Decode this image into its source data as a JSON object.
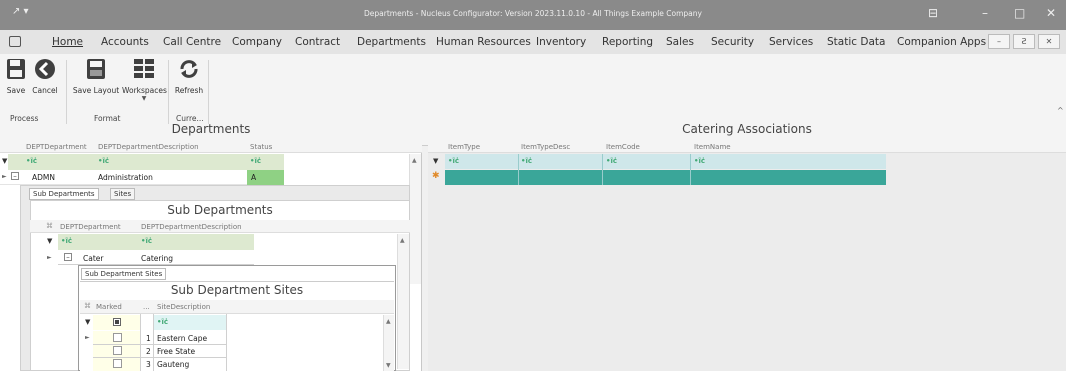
{
  "window": {
    "title": "Departments - Nucleus Configurator: Version 2023.11.0.10 - All Things Example Company",
    "quick_access": "↗ ▾",
    "controls": {
      "restore_panel": "⊟",
      "minimize": "–",
      "maximize": "□",
      "close": "✕"
    }
  },
  "menu": {
    "items": [
      "Home",
      "Accounts",
      "Call Centre",
      "Company",
      "Contract",
      "Departments",
      "Human Resources",
      "Inventory",
      "Reporting",
      "Sales",
      "Security",
      "Services",
      "Static Data",
      "Companion Apps"
    ],
    "active": "Home",
    "mdi_controls": [
      "–",
      "Ƨ",
      "✕"
    ]
  },
  "ribbon": {
    "groups": [
      {
        "label": "Process",
        "buttons": [
          "Save",
          "Cancel"
        ]
      },
      {
        "label": "Format",
        "buttons": [
          "Save Layout",
          "Workspaces"
        ]
      },
      {
        "label": "Curre...",
        "buttons": [
          "Refresh"
        ]
      }
    ],
    "collapse": "^"
  },
  "departments": {
    "title": "Departments",
    "columns": [
      "DEPTDepartment",
      "DEPTDepartmentDescription",
      "Status"
    ],
    "filter_symbol": "•ĩċ",
    "rows": [
      {
        "code": "ADMN",
        "description": "Administration",
        "status": "A"
      }
    ],
    "detail_tabs": [
      "Sub Departments",
      "Sites"
    ],
    "sub": {
      "title": "Sub Departments",
      "columns": [
        "DEPTDepartment",
        "DEPTDepartmentDescription"
      ],
      "rows": [
        {
          "code": "Cater",
          "description": "Catering"
        }
      ],
      "detail_tabs": [
        "Sub Department Sites"
      ],
      "sites": {
        "title": "Sub Department Sites",
        "columns": [
          "Marked",
          "...",
          "SiteDescription"
        ],
        "rows": [
          {
            "index": "1",
            "description": "Eastern Cape"
          },
          {
            "index": "2",
            "description": "Free State"
          },
          {
            "index": "3",
            "description": "Gauteng"
          }
        ]
      }
    }
  },
  "catering": {
    "title": "Catering Associations",
    "columns": [
      "ItemType",
      "ItemTypeDesc",
      "ItemCode",
      "ItemName"
    ]
  },
  "colors": {
    "titlebar": "#8a8a8a",
    "filter_row": "#dde9d0",
    "status_green": "#8fd184",
    "teal_row": "#3aa699",
    "accent_teal": "#4a9a90"
  }
}
